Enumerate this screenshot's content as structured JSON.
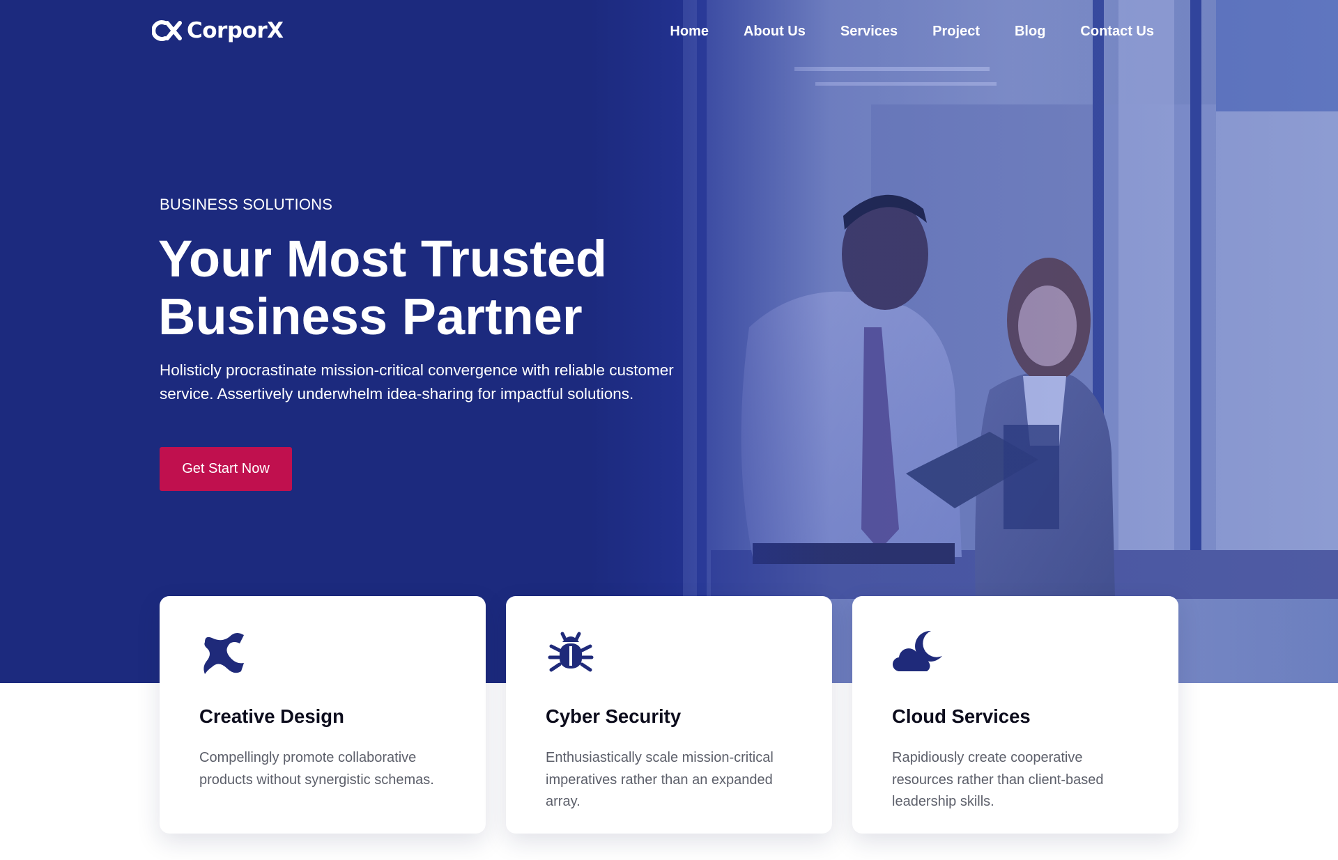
{
  "brand": {
    "name": "CorporX",
    "accent_color": "#c0104e",
    "primary_color": "#1e2a7c"
  },
  "nav": {
    "items": [
      {
        "label": "Home"
      },
      {
        "label": "About Us"
      },
      {
        "label": "Services"
      },
      {
        "label": "Project"
      },
      {
        "label": "Blog"
      },
      {
        "label": "Contact Us"
      }
    ]
  },
  "hero": {
    "eyebrow": "BUSINESS SOLUTIONS",
    "headline_line1": "Your Most Trusted",
    "headline_line2": "Business Partner",
    "intro": "Holisticly procrastinate mission-critical convergence with reliable customer service. Assertively underwhelm idea-sharing for impactful solutions.",
    "cta_label": "Get Start Now",
    "photo": "two-business-people-with-tablet"
  },
  "services": [
    {
      "icon": "creative-design-icon",
      "title": "Creative Design",
      "description": "Compellingly promote collaborative products without synergistic schemas."
    },
    {
      "icon": "bug-icon",
      "title": "Cyber Security",
      "description": "Enthusiastically scale mission-critical imperatives rather than an expanded array."
    },
    {
      "icon": "cloud-moon-icon",
      "title": "Cloud Services",
      "description": "Rapidiously create cooperative resources rather than client-based leadership skills."
    }
  ]
}
